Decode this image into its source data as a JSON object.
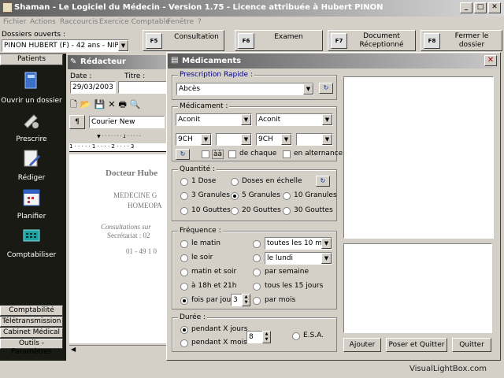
{
  "app": {
    "title": "Shaman - Le Logiciel du Médecin - Version 1.75 - Licence attribuée à Hubert PINON",
    "win_min": "_",
    "win_max": "□",
    "win_close": "✕"
  },
  "menu": [
    "Fichier",
    "Actions",
    "Raccourcis",
    "Exercice Comptable",
    "Fenêtre",
    "?"
  ],
  "dossiers": {
    "label": "Dossiers ouverts :",
    "value": "PINON HUBERT (F) - 42 ans - NIP :"
  },
  "fkeys": [
    {
      "key": "F5",
      "label": "Consultation"
    },
    {
      "key": "F6",
      "label": "Examen"
    },
    {
      "key": "F7",
      "label": "Document Réceptionné"
    },
    {
      "key": "F8",
      "label": "Fermer le dossier"
    }
  ],
  "sidebar": {
    "header": "Patients",
    "items": [
      "Ouvrir un dossier",
      "Prescrire",
      "Rédiger",
      "Planifier",
      "Comptabiliser"
    ],
    "tabs": [
      "Comptabilité",
      "Télétransmission",
      "Cabinet Médical",
      "Outils - Paramètres"
    ]
  },
  "redacteur": {
    "title": "Rédacteur",
    "date_label": "Date :",
    "date_value": "29/03/2003",
    "titre_label": "Titre :",
    "font": "Courier New",
    "doc_lines": [
      "Docteur Hube",
      "MEDECINE G",
      "HOMEOPA",
      "Consultations sur",
      "Secrétariat : 02",
      "01 - 49 1 0"
    ],
    "ruler": "1 · · · · · 1 · · · · 2 · · · · 3"
  },
  "dialog": {
    "title": "Médicaments",
    "close": "✕",
    "prescription": {
      "label": "Prescription Rapide :",
      "value": "Abcès"
    },
    "medicament": {
      "label": "Médicament :",
      "combo1": "Aconit",
      "combo2": "Aconit",
      "dil1": "9CH",
      "dil2": "9CH",
      "aa": "àà",
      "de_chaque": "de chaque",
      "alternance": "en alternance"
    },
    "quantite": {
      "label": "Quantité :",
      "options": [
        "1 Dose",
        "Doses en échelle",
        "3 Granules",
        "5 Granules",
        "10 Granules",
        "10 Gouttes",
        "20 Gouttes",
        "30 Gouttes"
      ],
      "selected": "5 Granules"
    },
    "frequence": {
      "label": "Fréquence :",
      "left": [
        "le matin",
        "le soir",
        "matin et soir",
        "à 18h et 21h",
        "fois par jour"
      ],
      "count": "3",
      "right_combo1": "toutes les 10 mn",
      "right_combo2": "le lundi",
      "right": [
        "par semaine",
        "tous les 15 jours",
        "par mois"
      ],
      "selected": "fois par jour"
    },
    "duree": {
      "label": "Durée :",
      "options": [
        "pendant X jours",
        "pendant X mois"
      ],
      "value": "8",
      "esa": "E.S.A.",
      "selected": "pendant X jours"
    },
    "buttons": [
      "Ajouter",
      "Poser et Quitter",
      "Quitter"
    ]
  },
  "watermark": "VisualLightBox.com"
}
